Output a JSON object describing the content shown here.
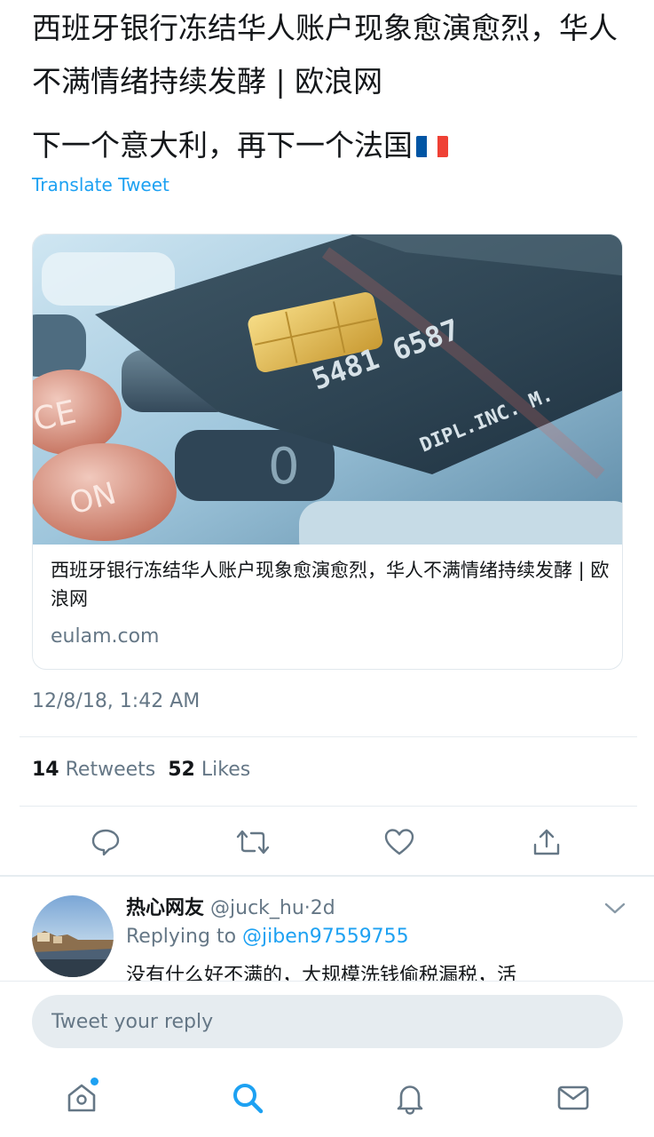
{
  "tweet": {
    "text_line1": "西班牙银行冻结华人账户现象愈演愈烈，华人不满情绪持续发酵 | 欧浪网",
    "text_line2": "下一个意大利，再下一个法国",
    "flag_icon": "france-flag-icon",
    "translate_label": "Translate Tweet",
    "timestamp": "12/8/18, 1:42 AM"
  },
  "card": {
    "image_icon": "credit-card-photo",
    "card_number_on_image": "5481 6587",
    "card_holder_on_image": "DIPL.INC. M.",
    "keypad_labels": [
      "CE",
      "ON",
      "0"
    ],
    "title": "西班牙银行冻结华人账户现象愈演愈烈，华人不满情绪持续发酵 | 欧浪网",
    "domain": "eulam.com"
  },
  "stats": {
    "retweets_count": "14",
    "retweets_label": "Retweets",
    "likes_count": "52",
    "likes_label": "Likes"
  },
  "actions": [
    {
      "name": "reply-action-button",
      "icon": "comment-icon"
    },
    {
      "name": "retweet-action-button",
      "icon": "retweet-icon"
    },
    {
      "name": "like-action-button",
      "icon": "heart-icon"
    },
    {
      "name": "share-action-button",
      "icon": "share-icon"
    }
  ],
  "reply": {
    "name": "热心网友",
    "handle": "@juck_hu",
    "separator": "·",
    "age": "2d",
    "replying_to_label": "Replying to",
    "replying_to_handle": "@jiben97559755",
    "text": "没有什么好不满的，大规模洗钱偷税漏税，活"
  },
  "composer": {
    "placeholder": "Tweet your reply"
  },
  "tabbar": {
    "items": [
      {
        "name": "tab-home",
        "icon": "home-icon",
        "active": false,
        "has_dot": true
      },
      {
        "name": "tab-search",
        "icon": "search-icon",
        "active": true,
        "has_dot": false
      },
      {
        "name": "tab-notifications",
        "icon": "bell-icon",
        "active": false,
        "has_dot": false
      },
      {
        "name": "tab-messages",
        "icon": "mail-icon",
        "active": false,
        "has_dot": false
      }
    ]
  },
  "colors": {
    "accent": "#1da1f2",
    "text_primary": "#14171a",
    "text_secondary": "#657786",
    "divider": "#e6ecf0",
    "flag_blue": "#0055a4",
    "flag_white": "#ffffff",
    "flag_red": "#ef4135"
  }
}
